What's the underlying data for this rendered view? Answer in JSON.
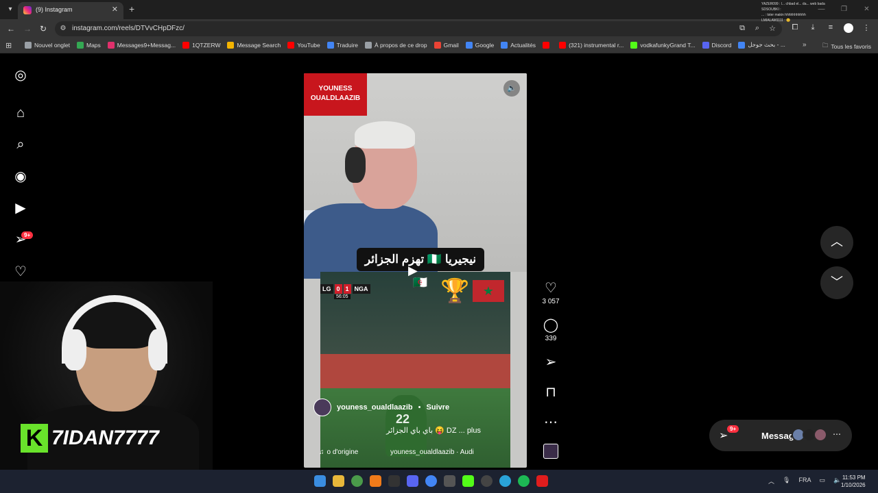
{
  "browser": {
    "tab_title": "(9) Instagram",
    "url": "instagram.com/reels/DTVvCHpDFzc/",
    "bookmarks": [
      {
        "label": "Nouvel onglet",
        "color": "#9aa0a6"
      },
      {
        "label": "Maps",
        "color": "#34a853"
      },
      {
        "label": "Messages9+Messag...",
        "color": "#e1306c"
      },
      {
        "label": "1QTZERW",
        "color": "#ff0000"
      },
      {
        "label": "Message Search",
        "color": "#f4b400"
      },
      {
        "label": "YouTube",
        "color": "#ff0000"
      },
      {
        "label": "Traduire",
        "color": "#4285f4"
      },
      {
        "label": "À propos de ce drop",
        "color": "#9aa0a6"
      },
      {
        "label": "Gmail",
        "color": "#ea4335"
      },
      {
        "label": "Google",
        "color": "#4285f4"
      },
      {
        "label": "Actualités",
        "color": "#4285f4"
      },
      {
        "label": "",
        "color": "#ff0000"
      },
      {
        "label": "(321) instrumental r...",
        "color": "#ff0000"
      },
      {
        "label": "vodkafunkyGrand T...",
        "color": "#53fc18"
      },
      {
        "label": "Discord",
        "color": "#5865f2"
      },
      {
        "label": "بحث جوجل - ...",
        "color": "#4285f4"
      }
    ],
    "all_bookmarks": "Tous les favoris"
  },
  "sidebar": {
    "notifications_badge": "9+"
  },
  "reel": {
    "name_line1": "YOUNESS",
    "name_line2": "OUALDLAAZIB",
    "caption_overlay": "نيجيريا 🇳🇬 تهزم الجزائر 🇩🇿",
    "score": {
      "team1": "LG",
      "goals1": "0",
      "goals2": "1",
      "team2": "NGA",
      "time": "56:05"
    },
    "player_number": "22",
    "username": "youness_oualdlaazib",
    "follow": "Suivre",
    "caption": "باي باي الجزائر 😝 DZ ... plus",
    "audio_left": "o d'origine",
    "audio_right": "youness_oualdlaazib · Audi"
  },
  "actions": {
    "likes": "3 057",
    "comments": "339"
  },
  "messages": {
    "label": "Messages",
    "badge": "9+"
  },
  "overlay_chat": [
    "YAZER099 : l... chbad el... da... web bada",
    "SDSOUBKI :",
    "... : tster makin hhhhhhhhhhh",
    "LMIALAM1111 : 😊"
  ],
  "streamer": {
    "logo": "K",
    "name": "7IDAN7777"
  },
  "taskbar": {
    "lang": "FRA",
    "time": "11:53 PM",
    "date": "1/10/2026"
  }
}
